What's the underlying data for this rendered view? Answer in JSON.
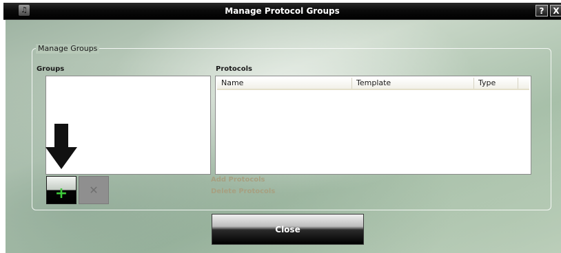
{
  "window": {
    "title": "Manage Protocol Groups",
    "app_icon_glyph": "♫",
    "help_label": "?",
    "close_label": "X"
  },
  "manage_groups": {
    "section_title": "Manage Groups",
    "groups_label": "Groups",
    "groups": [],
    "protocols_label": "Protocols",
    "protocols_columns": [
      "Name",
      "Template",
      "Type"
    ],
    "protocols_rows": [],
    "add_group_icon": "plus-icon",
    "delete_group_icon": "x-icon",
    "add_group_glyph": "+",
    "delete_group_glyph": "✕",
    "add_protocols_label": "Add Protocols",
    "delete_protocols_label": "Delete Protocols"
  },
  "footer": {
    "close_button_label": "Close"
  },
  "colors": {
    "titlebar": "#000000",
    "link_disabled": "#a7a081",
    "add_icon_green": "#3ecb3a",
    "background_green": "#b7c9b6"
  }
}
